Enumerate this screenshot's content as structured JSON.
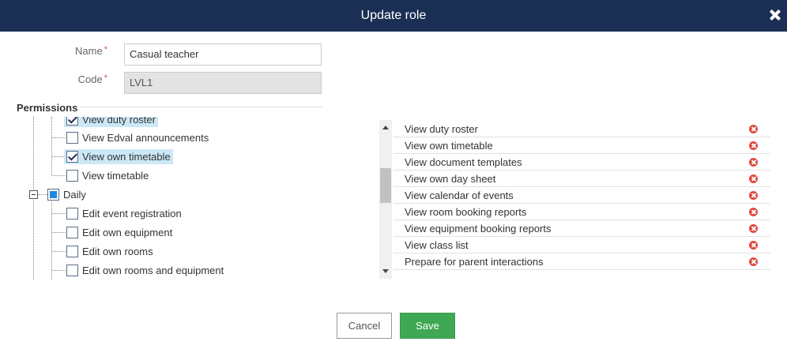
{
  "dialog": {
    "title": "Update role"
  },
  "form": {
    "name_label": "Name",
    "name_value": "Casual teacher",
    "code_label": "Code",
    "code_value": "LVL1",
    "required_mark": "*"
  },
  "permissions": {
    "section_title": "Permissions",
    "tree": [
      {
        "label": "View duty roster",
        "state": "checked",
        "level": 2,
        "highlight": true,
        "clipped": true
      },
      {
        "label": "View Edval announcements",
        "state": "unchecked",
        "level": 2
      },
      {
        "label": "View own timetable",
        "state": "checked",
        "level": 2,
        "highlight": true
      },
      {
        "label": "View timetable",
        "state": "unchecked",
        "level": 2
      },
      {
        "label": "Daily",
        "state": "partial",
        "level": 1,
        "expanded": true
      },
      {
        "label": "Edit event registration",
        "state": "unchecked",
        "level": 2
      },
      {
        "label": "Edit own equipment",
        "state": "unchecked",
        "level": 2
      },
      {
        "label": "Edit own rooms",
        "state": "unchecked",
        "level": 2
      },
      {
        "label": "Edit own rooms and equipment",
        "state": "unchecked",
        "level": 2
      }
    ],
    "selected": [
      "View duty roster",
      "View own timetable",
      "View document templates",
      "View own day sheet",
      "View calendar of events",
      "View room booking reports",
      "View equipment booking reports",
      "View class list",
      "Prepare for parent interactions"
    ]
  },
  "footer": {
    "cancel_label": "Cancel",
    "save_label": "Save"
  },
  "colors": {
    "titlebar": "#1b2f55",
    "save": "#3fa854",
    "remove": "#e0483e",
    "highlight": "#cce8f6"
  }
}
